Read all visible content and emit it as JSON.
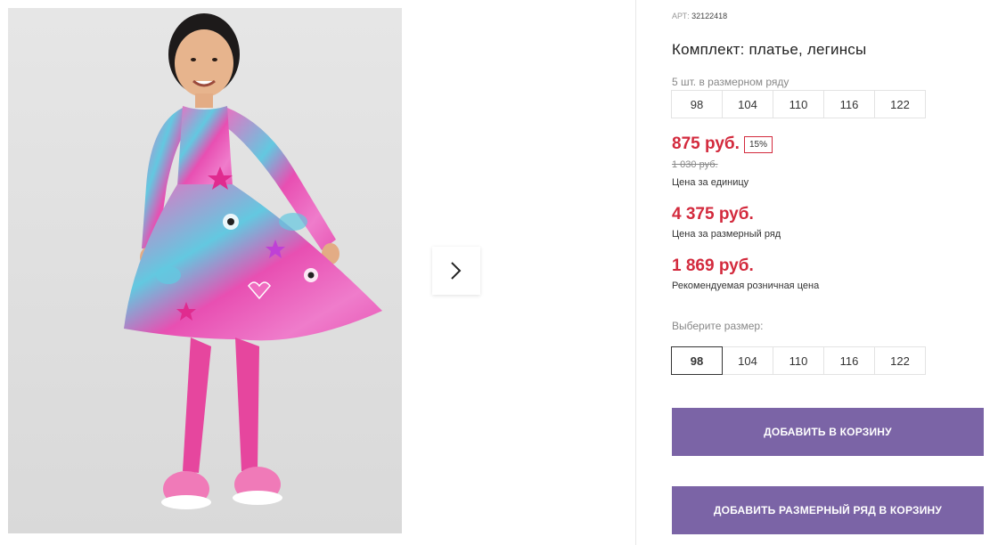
{
  "gallery": {
    "next_icon": "chevron-right-icon"
  },
  "product": {
    "article_label": "АРТ:",
    "article_number": "32122418",
    "title": "Комплект: платье, легинсы"
  },
  "size_range": {
    "label": "5 шт. в размерном ряду",
    "sizes": [
      "98",
      "104",
      "110",
      "116",
      "122"
    ]
  },
  "pricing": {
    "unit_price": "875 руб.",
    "discount": "15%",
    "old_price": "1 030 руб.",
    "unit_note": "Цена за единицу",
    "range_price": "4 375 руб.",
    "range_note": "Цена за размерный ряд",
    "retail_price": "1 869 руб.",
    "retail_note": "Рекомендуемая розничная цена"
  },
  "size_select": {
    "label": "Выберите размер:",
    "sizes": [
      "98",
      "104",
      "110",
      "116",
      "122"
    ],
    "selected": "98"
  },
  "actions": {
    "add_to_cart": "ДОБАВИТЬ В КОРЗИНУ",
    "add_range_to_cart": "ДОБАВИТЬ РАЗМЕРНЫЙ РЯД В КОРЗИНУ"
  },
  "colors": {
    "accent": "#7b64a6",
    "price_red": "#d32a3d",
    "dress_pink": "#e94fb0",
    "dress_blue": "#59c6dc"
  }
}
